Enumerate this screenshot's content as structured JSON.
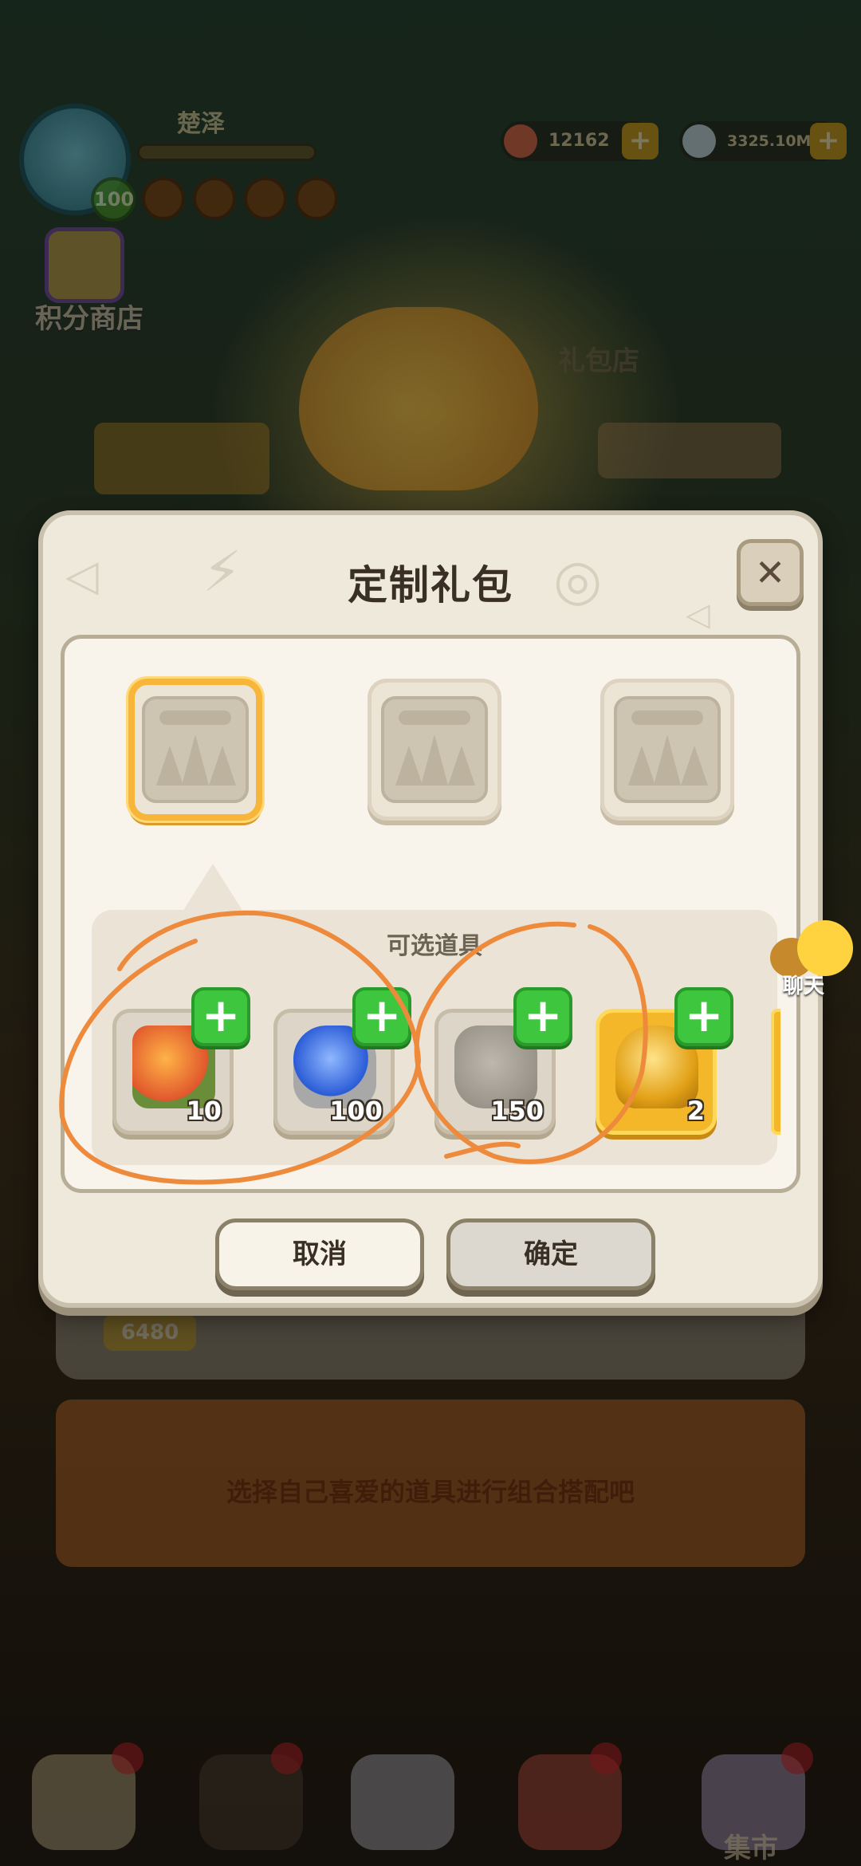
{
  "hud": {
    "player_name": "楚泽",
    "level": "100",
    "currency_1": "12162",
    "currency_2": "3325.10M",
    "points_shop_label": "积分商店",
    "gift_shop_label": "礼包店"
  },
  "dialog": {
    "title": "定制礼包",
    "close_icon": "close-icon",
    "slots": [
      {
        "state": "selected"
      },
      {
        "state": "empty"
      },
      {
        "state": "empty"
      }
    ],
    "tray_title": "可选道具",
    "items": [
      {
        "icon": "food-platter-icon",
        "count": "10"
      },
      {
        "icon": "blue-rune-gem-icon",
        "count": "100"
      },
      {
        "icon": "paw-stone-tablet-icon",
        "count": "150"
      },
      {
        "icon": "gold-crystal-icon",
        "count": "2"
      }
    ],
    "cancel_label": "取消",
    "confirm_label": "确定"
  },
  "chat": {
    "label": "聊天"
  },
  "background": {
    "under_count": "6480",
    "hint": "选择自己喜爱的道具进行组合搭配吧",
    "market_tab_label": "集市"
  },
  "colors": {
    "accent_gold": "#f7b63a",
    "plus_green": "#3ec63e",
    "annotation_orange": "#ee8a3c"
  }
}
